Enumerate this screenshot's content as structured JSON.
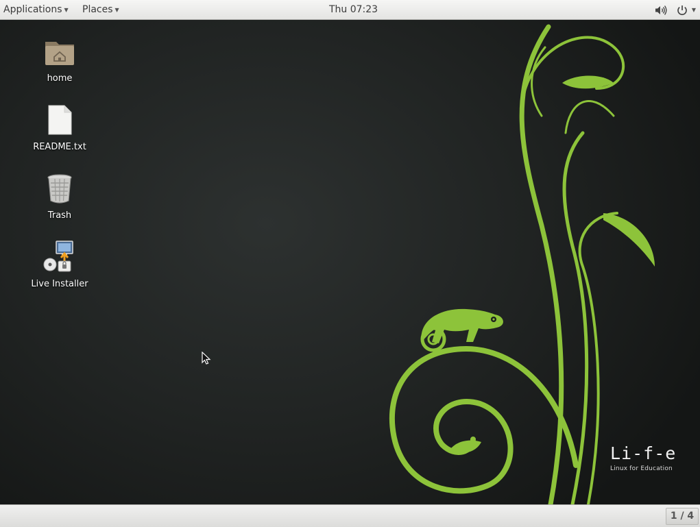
{
  "top_panel": {
    "applications_label": "Applications",
    "places_label": "Places",
    "clock": "Thu 07:23",
    "volume_icon": "volume-icon",
    "power_icon": "power-icon"
  },
  "desktop": {
    "icons": [
      {
        "label": "home",
        "icon": "home-folder-icon"
      },
      {
        "label": "README.txt",
        "icon": "text-file-icon"
      },
      {
        "label": "Trash",
        "icon": "trash-icon"
      },
      {
        "label": "Live Installer",
        "icon": "live-installer-icon"
      }
    ],
    "branding": {
      "logo_text": "Li-f-e",
      "tagline": "Linux for Education"
    }
  },
  "bottom_panel": {
    "workspace_indicator": "1 / 4"
  },
  "colors": {
    "panel_bg": "#ececea",
    "desktop_bg": "#1f2221",
    "leaf_green": "#8dc33a",
    "label_text": "#ffffff"
  }
}
